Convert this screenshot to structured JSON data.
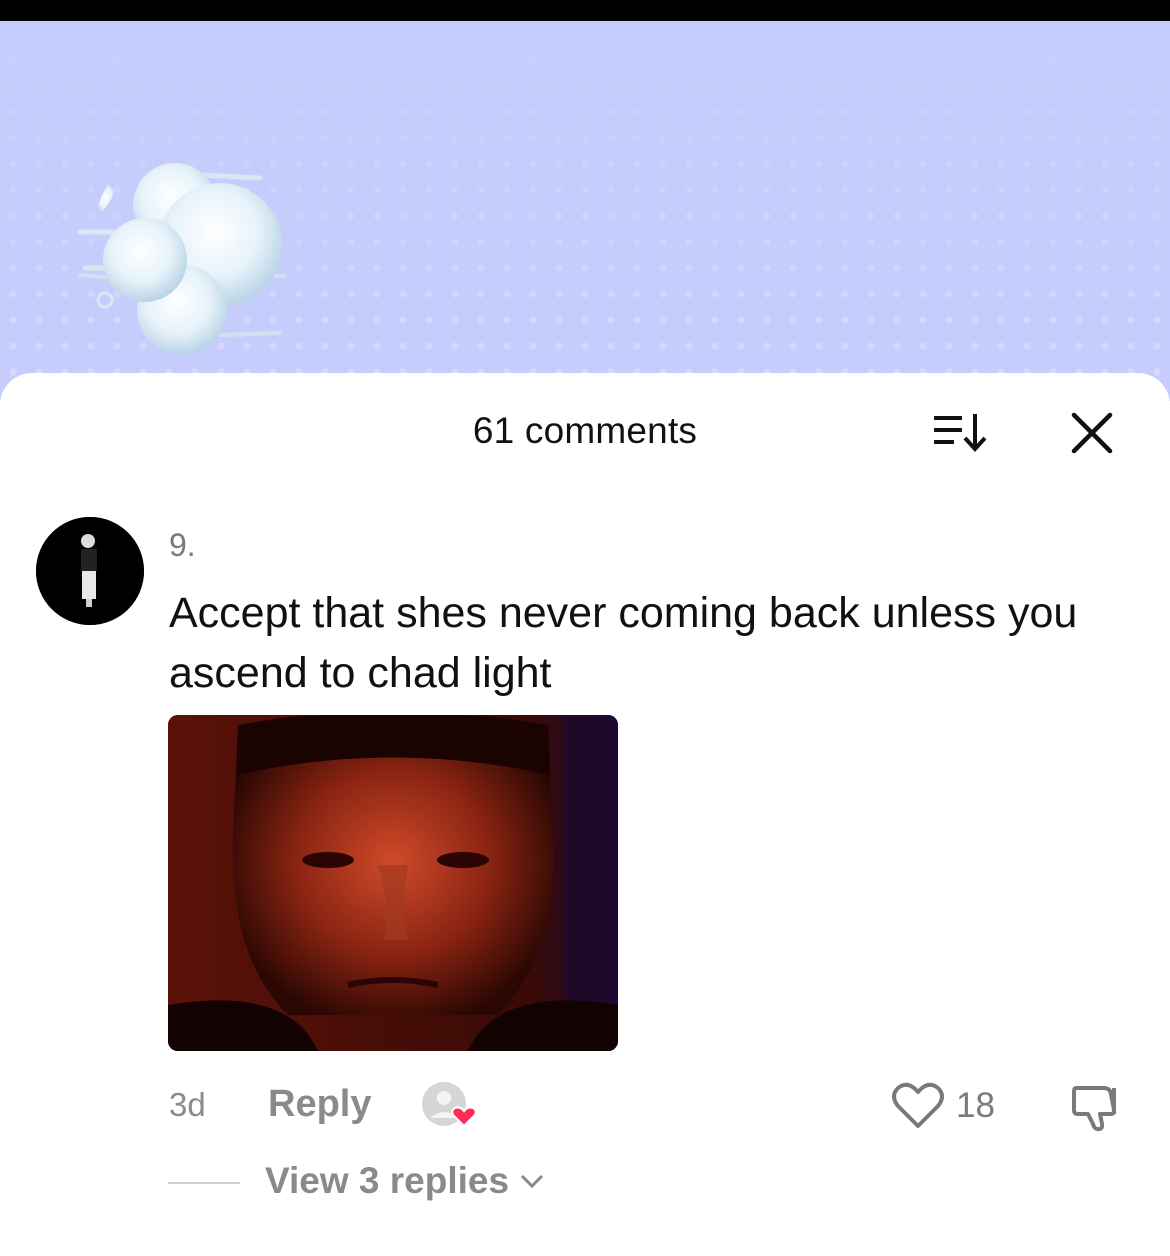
{
  "header": {
    "title": "61 comments",
    "sort_icon": "sort-icon",
    "close_icon": "close-icon"
  },
  "colors": {
    "background_video": "#c6cdfd",
    "like_heart": "#fe2c55",
    "secondary_text": "#8a8a8a"
  },
  "comment": {
    "username": "9.",
    "text": "Accept that shes never coming back unless you ascend to chad light",
    "time": "3d",
    "reply_label": "Reply",
    "like_count": "18",
    "view_replies_label": "View 3 replies"
  }
}
